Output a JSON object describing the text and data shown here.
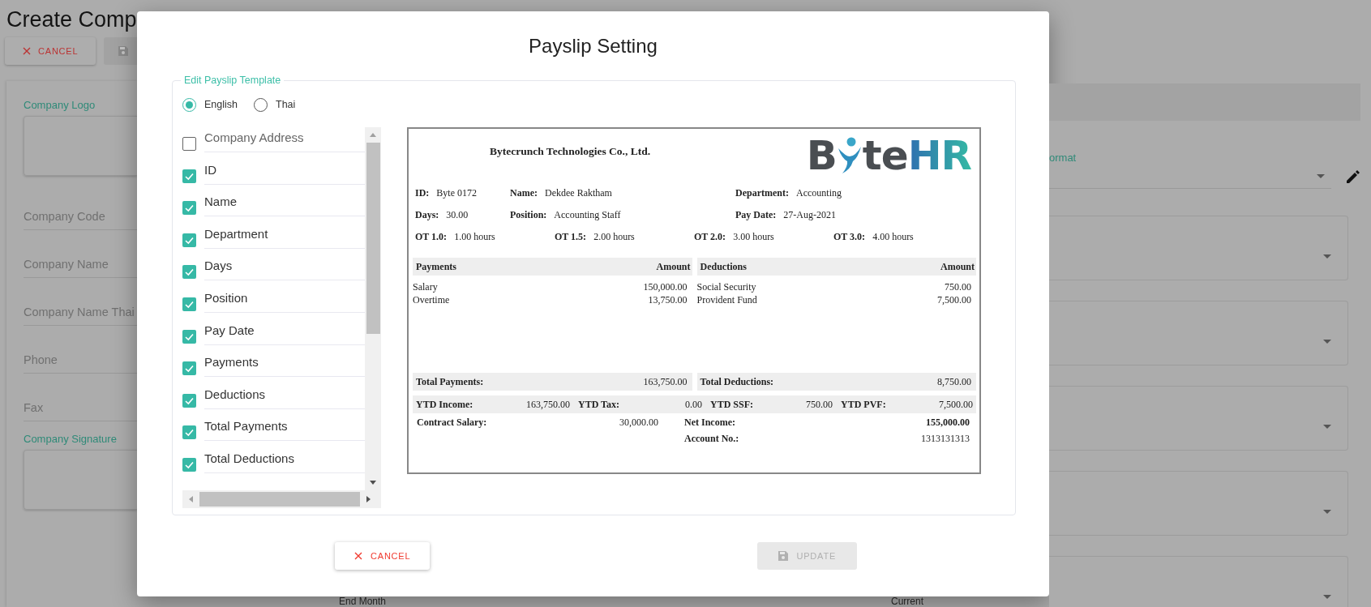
{
  "background": {
    "page_title": "Create Comp",
    "cancel_button": "CANCEL",
    "left_fields": [
      {
        "label": "Company Logo",
        "kind": "upload"
      },
      {
        "label": "Company Code",
        "kind": "text"
      },
      {
        "label": "Company Name",
        "kind": "text"
      },
      {
        "label": "Company Name Thai",
        "kind": "text"
      },
      {
        "label": "Phone",
        "kind": "text"
      },
      {
        "label": "Fax",
        "kind": "text"
      },
      {
        "label": "Company Signature",
        "kind": "upload"
      }
    ],
    "format_label": "ormat",
    "bottom_texts": [
      "End Month",
      "Current"
    ]
  },
  "dialog": {
    "title": "Payslip Setting",
    "legend": "Edit Payslip Template",
    "languages": [
      {
        "label": "English",
        "selected": true
      },
      {
        "label": "Thai",
        "selected": false
      }
    ],
    "fields": [
      {
        "label": "Company Address",
        "checked": false
      },
      {
        "label": "ID",
        "checked": true
      },
      {
        "label": "Name",
        "checked": true
      },
      {
        "label": "Department",
        "checked": true
      },
      {
        "label": "Days",
        "checked": true
      },
      {
        "label": "Position",
        "checked": true
      },
      {
        "label": "Pay Date",
        "checked": true
      },
      {
        "label": "Payments",
        "checked": true
      },
      {
        "label": "Deductions",
        "checked": true
      },
      {
        "label": "Total Payments",
        "checked": true
      },
      {
        "label": "Total Deductions",
        "checked": true
      }
    ],
    "preview": {
      "company": "Bytecrunch Technologies Co., Ltd.",
      "logo": {
        "start": "B",
        "middle": "te",
        "end": "HR"
      },
      "info_rows": [
        [
          {
            "label": "ID:",
            "value": "Byte 0172"
          },
          {
            "label": "Name:",
            "value": "Dekdee Raktham"
          },
          {
            "label": "Department:",
            "value": "Accounting"
          }
        ],
        [
          {
            "label": "Days:",
            "value": "30.00"
          },
          {
            "label": "Position:",
            "value": "Accounting Staff"
          },
          {
            "label": "Pay Date:",
            "value": "27-Aug-2021"
          }
        ]
      ],
      "ot": [
        {
          "label": "OT 1.0:",
          "value": "1.00 hours"
        },
        {
          "label": "OT 1.5:",
          "value": "2.00 hours"
        },
        {
          "label": "OT 2.0:",
          "value": "3.00 hours"
        },
        {
          "label": "OT 3.0:",
          "value": "4.00 hours"
        }
      ],
      "payments": {
        "heading": "Payments",
        "amount_heading": "Amount",
        "items": [
          {
            "name": "Salary",
            "amount": "150,000.00"
          },
          {
            "name": "Overtime",
            "amount": "13,750.00"
          }
        ],
        "total_label": "Total Payments:",
        "total": "163,750.00"
      },
      "deductions": {
        "heading": "Deductions",
        "amount_heading": "Amount",
        "items": [
          {
            "name": "Social Security",
            "amount": "750.00"
          },
          {
            "name": "Provident Fund",
            "amount": "7,500.00"
          }
        ],
        "total_label": "Total Deductions:",
        "total": "8,750.00"
      },
      "ytd": [
        {
          "label": "YTD Income:",
          "value": "163,750.00"
        },
        {
          "label": "YTD Tax:",
          "value": "0.00"
        },
        {
          "label": "YTD SSF:",
          "value": "750.00"
        },
        {
          "label": "YTD PVF:",
          "value": "7,500.00"
        }
      ],
      "contract": {
        "label": "Contract Salary:",
        "value": "30,000.00"
      },
      "net": {
        "label": "Net Income:",
        "value": "155,000.00"
      },
      "account": {
        "label": "Account No.:",
        "value": "1313131313"
      }
    },
    "cancel_button": "CANCEL",
    "update_button": {
      "label": "UPDATE",
      "disabled": true
    }
  }
}
